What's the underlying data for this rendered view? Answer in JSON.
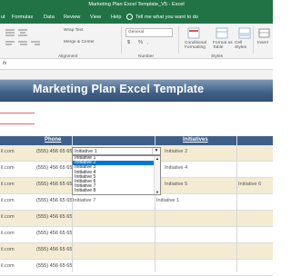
{
  "app": {
    "title": "Marketing Plan Excel Template_V5  -  Excel"
  },
  "ribbon_tabs": [
    "ut",
    "Formulas",
    "Data",
    "Review",
    "View",
    "Help"
  ],
  "tell_me": "Tell me what you want to do",
  "ribbon": {
    "wrap_text": "Wrap Text",
    "merge_center": "Merge & Center",
    "number_format": "General",
    "conditional_formatting": "Conditional Formatting",
    "format_as_table": "Format as Table",
    "cell_styles": "Cell Styles",
    "insert": "Insert",
    "group_alignment": "Alignment",
    "group_number": "Number",
    "group_styles": "Styles",
    "currency_symbol": "$",
    "percent_symbol": "%",
    "comma_symbol": ","
  },
  "formula_bar": {
    "fx": "fx"
  },
  "sheet": {
    "banner_title": "Marketing Plan Excel Template",
    "headers": {
      "phone": "Phone",
      "initiatives": "Initiatives"
    },
    "rows": [
      {
        "email": "il.com",
        "phone": "(555) 456 65 65",
        "initiative_b": "Initiative 2"
      },
      {
        "email": "il.com",
        "phone": "(555) 456 65 65",
        "initiative_b": "Initiative 4"
      },
      {
        "email": "il.com",
        "phone": "(555) 456 65 65",
        "initiative_b": "Initiative 5",
        "initiative_c": "Initiative 6"
      },
      {
        "email": "il.com",
        "phone": "(555) 456 65 65",
        "initiative_a": "Initiative 7",
        "initiative_b": "Initiative 1"
      },
      {
        "email": "il.com",
        "phone": "(555) 456 65 65"
      },
      {
        "email": "il.com",
        "phone": "(555) 456 65 65"
      },
      {
        "email": "il.com",
        "phone": "(555) 456 65 65"
      },
      {
        "email": "il.com",
        "phone": "(555) 456 65 65"
      }
    ],
    "dropdown": {
      "current_value": "Initiative 1",
      "options": [
        "Initiative 1",
        "Initiative 2",
        "Initiative 3",
        "Initiative 4",
        "Initiative 5",
        "Initiative 6",
        "Initiative 7",
        "Initiative 8"
      ],
      "selected_option": "Initiative 2"
    }
  },
  "colors": {
    "excel_green": "#217346",
    "banner_blue": "#3d5f8a",
    "alt_row": "#f3ecd3",
    "selection_blue": "#0078d7"
  }
}
